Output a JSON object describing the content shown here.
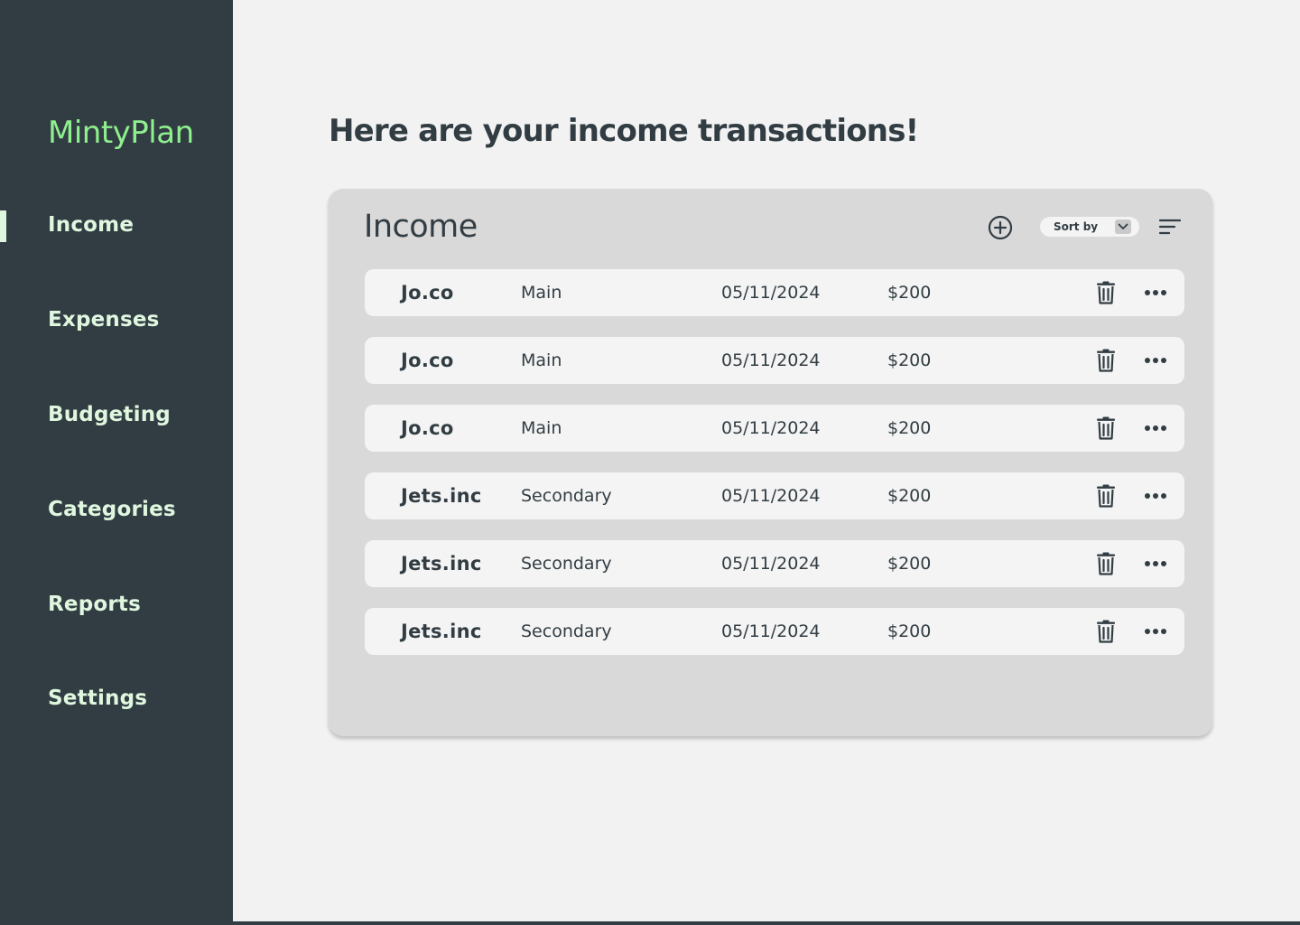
{
  "app": {
    "name": "MintyPlan",
    "colors": {
      "accent": "#8ff08f",
      "nav_text": "#dff7df",
      "sidebar": "#323d43",
      "active_marker": "#dff7df"
    }
  },
  "sidebar": {
    "active_item": "Income",
    "items": [
      {
        "label": "Income"
      },
      {
        "label": "Expenses"
      },
      {
        "label": "Budgeting"
      },
      {
        "label": "Categories"
      },
      {
        "label": "Reports"
      },
      {
        "label": "Settings"
      }
    ]
  },
  "page": {
    "title": "Here are your income transactions!"
  },
  "panel": {
    "title": "Income",
    "add_icon": "plus-circle-icon",
    "sort_label": "Sort by",
    "sort_icon": "chevron-down-icon",
    "filter_icon": "filter-lines-icon",
    "rows": [
      {
        "name": "Jo.co",
        "type": "Main",
        "date": "05/11/2024",
        "amount": "$200"
      },
      {
        "name": "Jo.co",
        "type": "Main",
        "date": "05/11/2024",
        "amount": "$200"
      },
      {
        "name": "Jo.co",
        "type": "Main",
        "date": "05/11/2024",
        "amount": "$200"
      },
      {
        "name": "Jets.inc",
        "type": "Secondary",
        "date": "05/11/2024",
        "amount": "$200"
      },
      {
        "name": "Jets.inc",
        "type": "Secondary",
        "date": "05/11/2024",
        "amount": "$200"
      },
      {
        "name": "Jets.inc",
        "type": "Secondary",
        "date": "05/11/2024",
        "amount": "$200"
      }
    ],
    "row_icons": {
      "delete": "trash-icon",
      "more": "more-dots-icon"
    }
  }
}
